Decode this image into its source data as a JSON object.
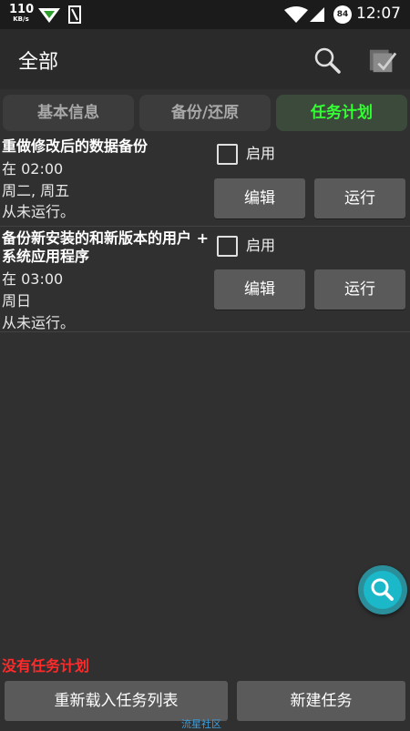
{
  "status_bar": {
    "speed_value": "110",
    "speed_unit": "KB/s",
    "battery": "84",
    "time": "12:07"
  },
  "action_bar": {
    "title": "全部",
    "icons": [
      "search-icon",
      "batch-check-icon"
    ]
  },
  "tabs": [
    {
      "label": "基本信息",
      "active": false
    },
    {
      "label": "备份/还原",
      "active": false
    },
    {
      "label": "任务计划",
      "active": true
    }
  ],
  "tasks": [
    {
      "title": "重做修改后的数据备份",
      "time": "在 02:00",
      "days": "周二, 周五",
      "last_run": "从未运行。",
      "enable_label": "启用",
      "enabled": false,
      "edit_label": "编辑",
      "run_label": "运行"
    },
    {
      "title": "备份新安装的和新版本的用户 + 系统应用程序",
      "time": "在 03:00",
      "days": "周日",
      "last_run": "从未运行。",
      "enable_label": "启用",
      "enabled": false,
      "edit_label": "编辑",
      "run_label": "运行"
    }
  ],
  "footer": {
    "no_tasks": "没有任务计划",
    "reload_label": "重新载入任务列表",
    "new_task_label": "新建任务",
    "watermark": "流星社区"
  },
  "colors": {
    "active_tab": "#33ff33",
    "warning": "#ff2a2a",
    "fab": "#1ab8c8"
  }
}
